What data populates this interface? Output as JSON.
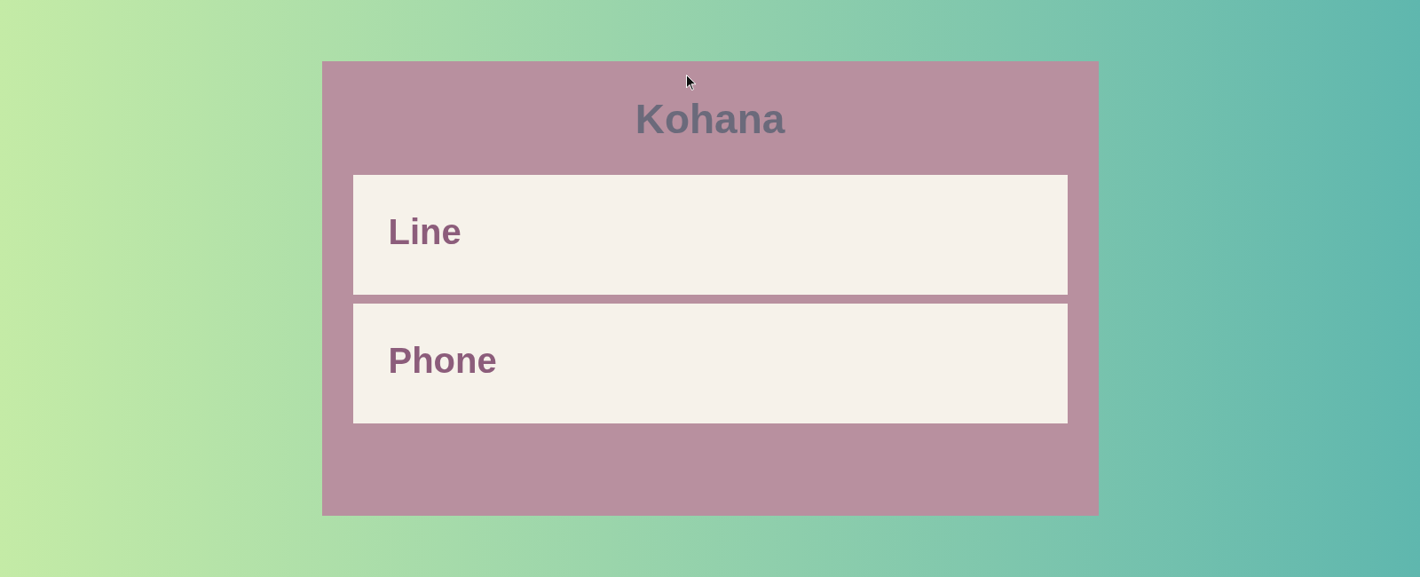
{
  "title": "Kohana",
  "fields": [
    {
      "label": "Line"
    },
    {
      "label": "Phone"
    }
  ]
}
